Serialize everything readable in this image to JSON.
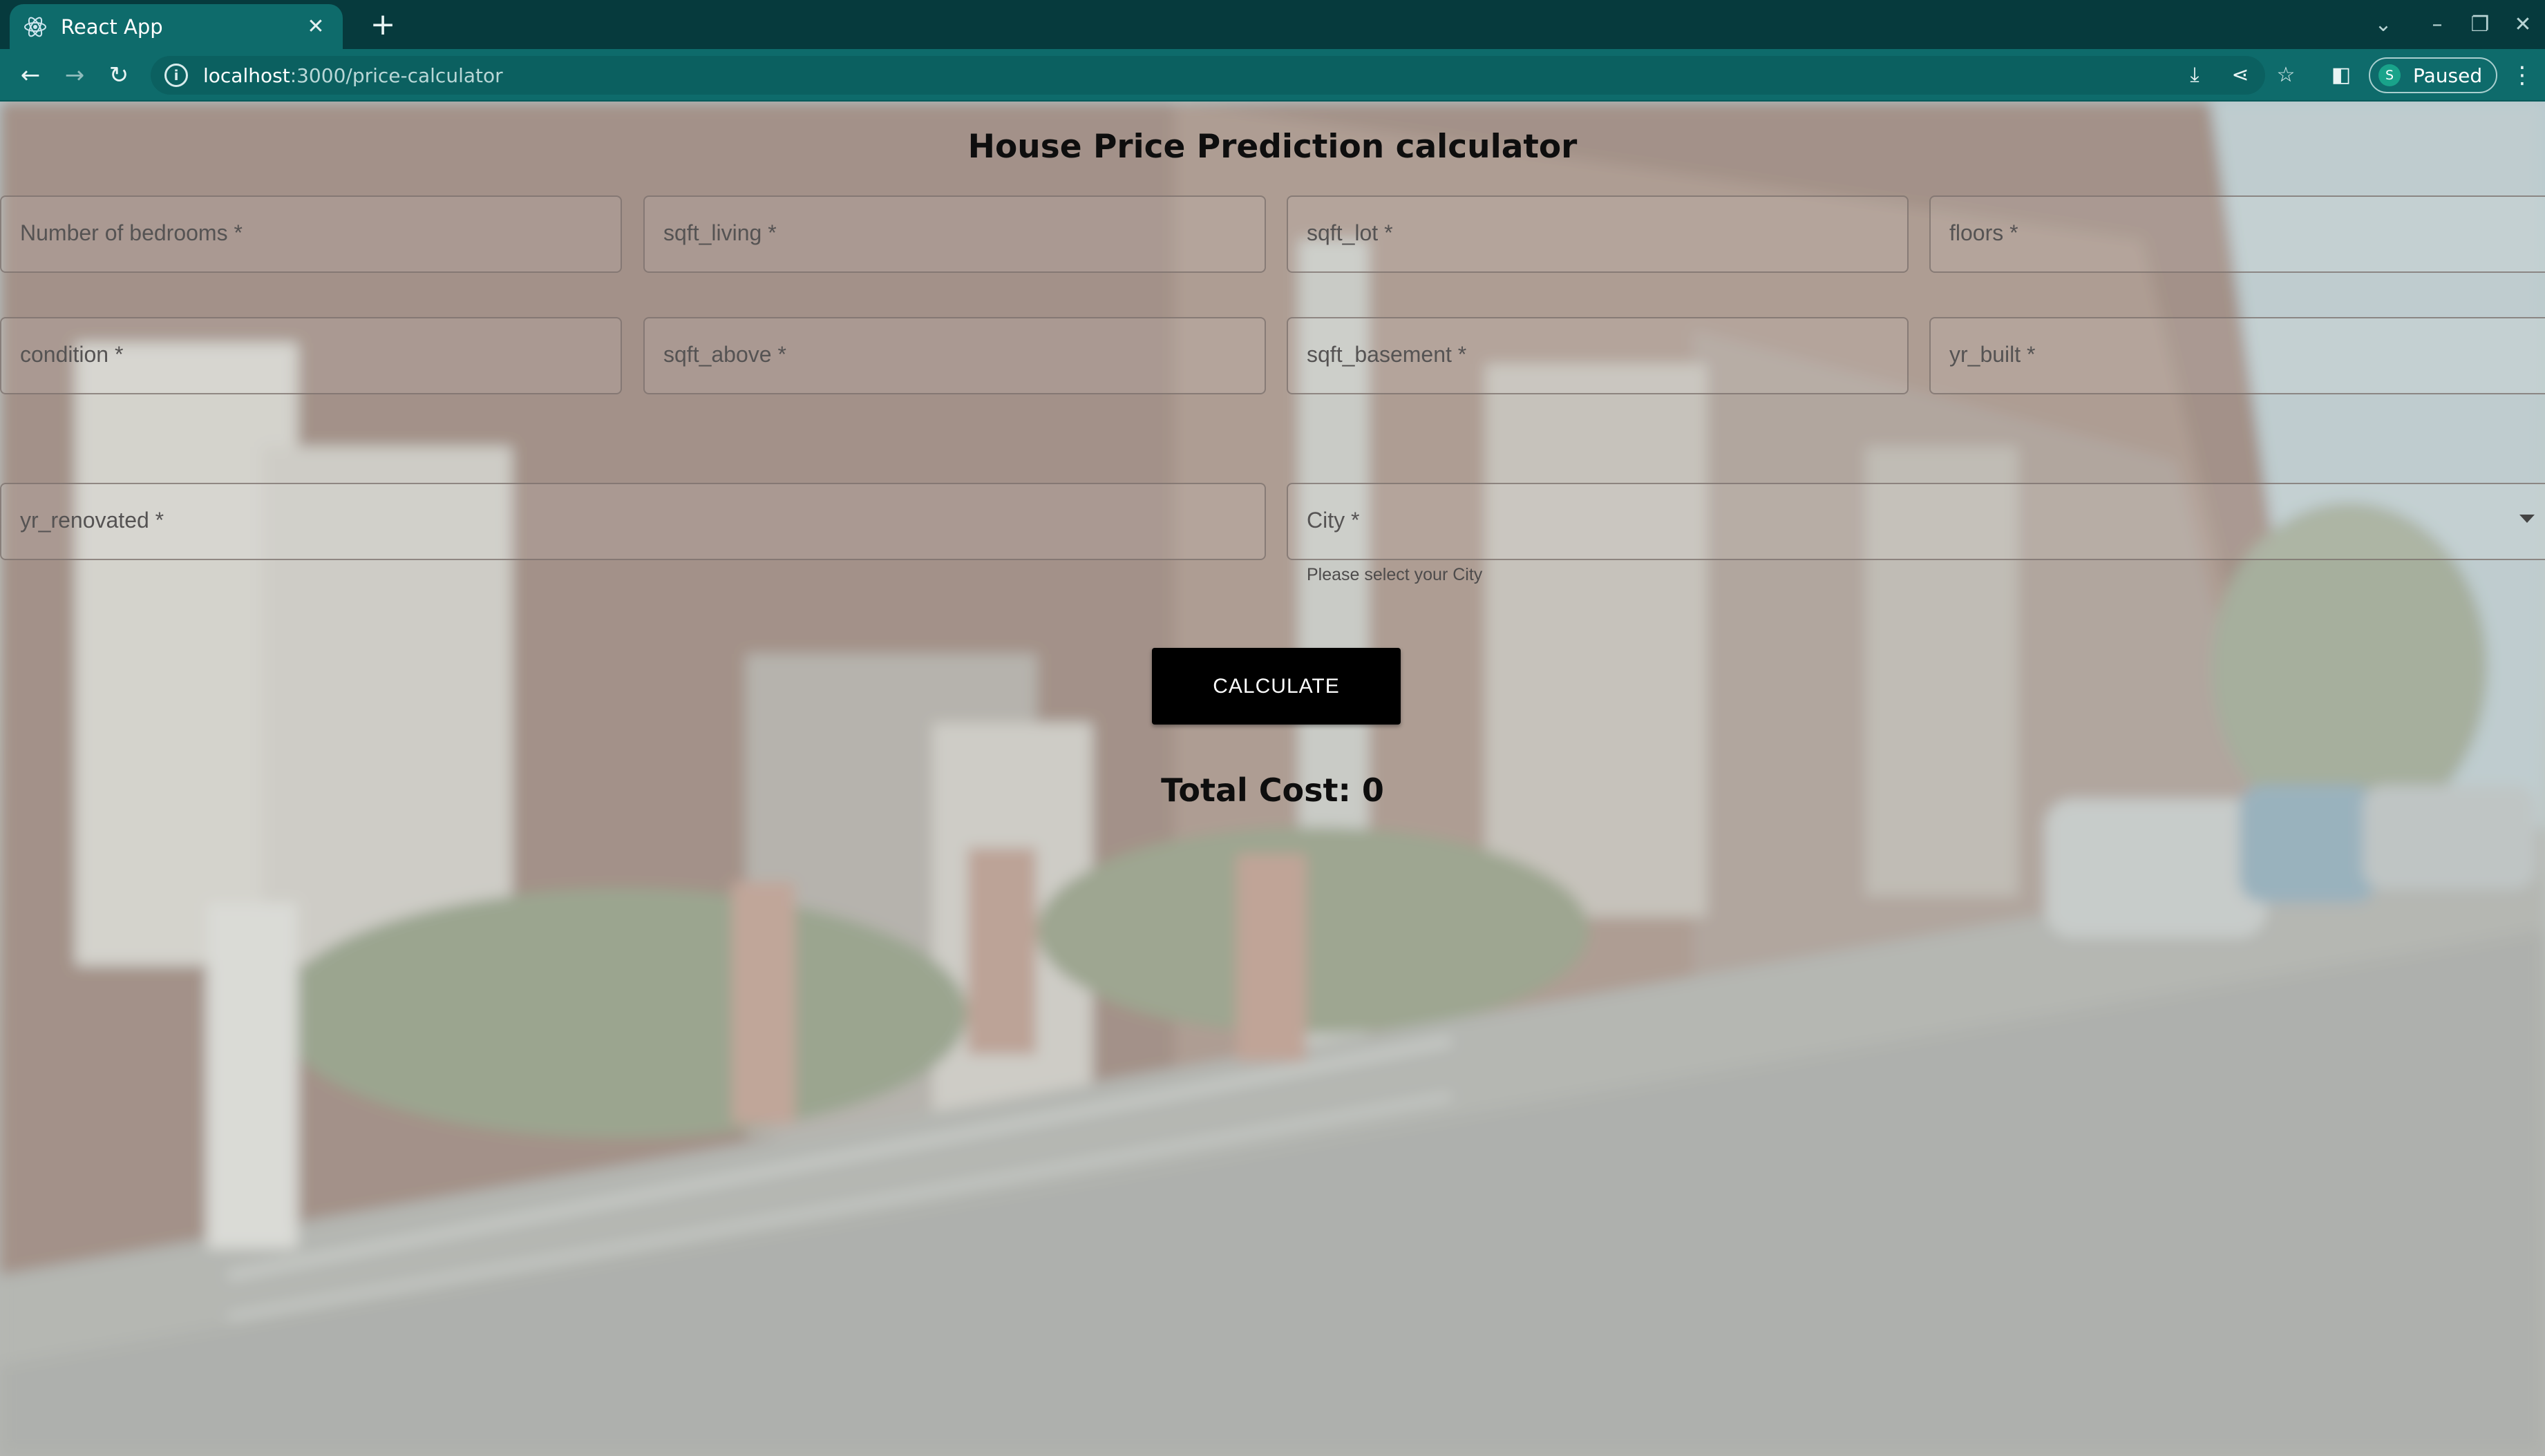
{
  "browser": {
    "tab_title": "React App",
    "tab_close": "✕",
    "new_tab": "+",
    "url_host": "localhost",
    "url_path": ":3000/price-calculator",
    "profile_initial": "S",
    "profile_status": "Paused"
  },
  "page": {
    "title": "House Price Prediction calculator",
    "fields_row1": [
      "Number of bedrooms *",
      "sqft_living *",
      "sqft_lot *",
      "floors *"
    ],
    "fields_row2": [
      "condition *",
      "sqft_above *",
      "sqft_basement *",
      "yr_built *"
    ],
    "yr_renovated": "yr_renovated *",
    "city": {
      "label": "City *",
      "helper": "Please select your City"
    },
    "calculate_label": "CALCULATE",
    "total_cost": "Total Cost: 0"
  },
  "icons": [
    "react-favicon",
    "tab-close-icon",
    "new-tab-icon",
    "back-icon",
    "forward-icon",
    "reload-icon",
    "site-info-icon",
    "install-icon",
    "share-icon",
    "bookmark-star-icon",
    "side-panel-icon",
    "menu-dots-icon",
    "tab-search-icon",
    "minimize-icon",
    "restore-icon",
    "close-window-icon",
    "dropdown-arrow-icon"
  ],
  "colors": {
    "chrome_dark": "#063a3d",
    "chrome_tab": "#0e6b6b",
    "button_bg": "#000000",
    "button_text": "#ffffff"
  }
}
